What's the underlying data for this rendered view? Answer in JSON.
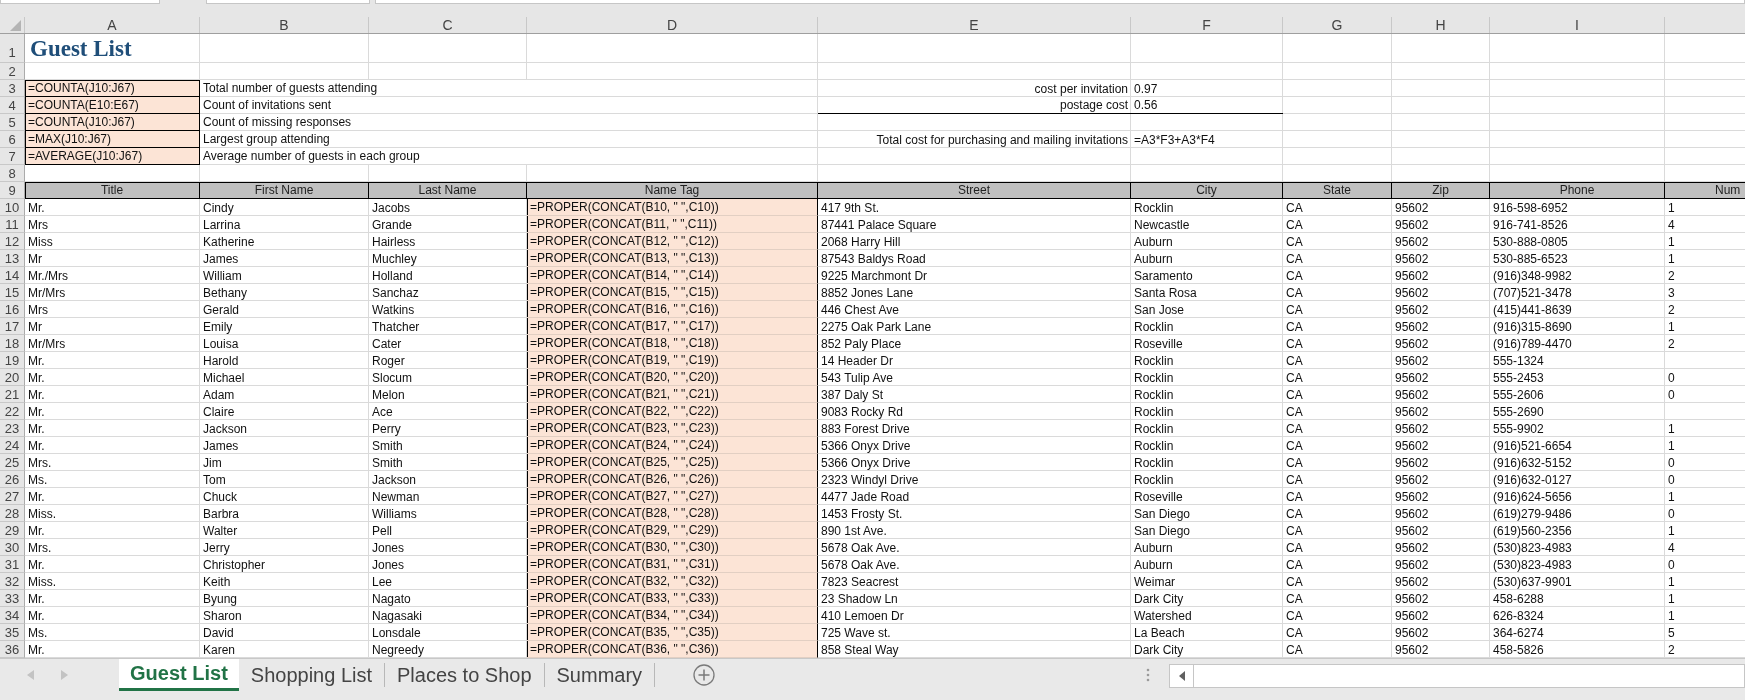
{
  "column_letters": [
    "A",
    "B",
    "C",
    "D",
    "E",
    "F",
    "G",
    "H",
    "I"
  ],
  "row_numbers": [
    "1",
    "2",
    "3",
    "4",
    "5",
    "6",
    "7",
    "8",
    "9",
    "10",
    "11",
    "12",
    "13",
    "14",
    "15",
    "16",
    "17",
    "18",
    "19",
    "20",
    "21",
    "22",
    "23",
    "24",
    "25",
    "26",
    "27",
    "28",
    "29",
    "30",
    "31",
    "32",
    "33",
    "34",
    "35",
    "36"
  ],
  "title": "Guest List",
  "summary": [
    {
      "formula": "=COUNTA(J10:J67)",
      "label": "Total number of guests attending"
    },
    {
      "formula": "=COUNTA(E10:E67)",
      "label": "Count of invitations sent"
    },
    {
      "formula": "=COUNTA(J10:J67)",
      "label": "Count of missing responses"
    },
    {
      "formula": "=MAX(J10:J67)",
      "label": "Largest group attending"
    },
    {
      "formula": "=AVERAGE(J10:J67)",
      "label": "Average number of guests in each group"
    }
  ],
  "costs": {
    "inputs": [
      {
        "label": "cost per invitation",
        "value": "0.97"
      },
      {
        "label": "postage cost",
        "value": "0.56"
      }
    ],
    "total": {
      "label": "Total cost for purchasing and mailing invitations",
      "value": "=A3*F3+A3*F4"
    }
  },
  "table": {
    "columns": [
      {
        "label": "Title",
        "kind": "text"
      },
      {
        "label": "First Name",
        "kind": "text"
      },
      {
        "label": "Last Name",
        "kind": "text"
      },
      {
        "label": "Name Tag",
        "kind": "formula"
      },
      {
        "label": "Street",
        "kind": "text"
      },
      {
        "label": "City",
        "kind": "text"
      },
      {
        "label": "State",
        "kind": "text"
      },
      {
        "label": "Zip",
        "kind": "text"
      },
      {
        "label": "Phone",
        "kind": "text"
      },
      {
        "label": "Num",
        "kind": "text"
      }
    ],
    "rows": [
      [
        "Mr.",
        "Cindy",
        "Jacobs",
        "=PROPER(CONCAT(B10, \" \",C10))",
        "417 9th St.",
        "Rocklin",
        "CA",
        "95602",
        "916-598-6952",
        "1"
      ],
      [
        "Mrs",
        "Larrina",
        "Grande",
        "=PROPER(CONCAT(B11, \" \",C11))",
        "87441 Palace Square",
        "Newcastle",
        "CA",
        "95602",
        "916-741-8526",
        "4"
      ],
      [
        "Miss",
        "Katherine",
        "Hairless",
        "=PROPER(CONCAT(B12, \" \",C12))",
        "2068 Harry Hill",
        "Auburn",
        "CA",
        "95602",
        "530-888-0805",
        "1"
      ],
      [
        "Mr",
        "James",
        "Muchley",
        "=PROPER(CONCAT(B13, \" \",C13))",
        "87543 Baldys Road",
        "Auburn",
        "CA",
        "95602",
        "530-885-6523",
        "1"
      ],
      [
        "Mr./Mrs",
        "William",
        "Holland",
        "=PROPER(CONCAT(B14, \" \",C14))",
        "9225 Marchmont Dr",
        "Saramento",
        "CA",
        "95602",
        "(916)348-9982",
        "2"
      ],
      [
        "Mr/Mrs",
        "Bethany",
        "Sanchaz",
        "=PROPER(CONCAT(B15, \" \",C15))",
        "8852 Jones Lane",
        "Santa Rosa",
        "CA",
        "95602",
        "(707)521-3478",
        "3"
      ],
      [
        "Mrs",
        "Gerald",
        "Watkins",
        "=PROPER(CONCAT(B16, \" \",C16))",
        "446 Chest Ave",
        "San Jose",
        "CA",
        "95602",
        "(415)441-8639",
        "2"
      ],
      [
        "Mr",
        "Emily",
        "Thatcher",
        "=PROPER(CONCAT(B17, \" \",C17))",
        "2275 Oak Park Lane",
        "Rocklin",
        "CA",
        "95602",
        "(916)315-8690",
        "1"
      ],
      [
        "Mr/Mrs",
        "Louisa",
        "Cater",
        "=PROPER(CONCAT(B18, \" \",C18))",
        "852 Paly Place",
        "Roseville",
        "CA",
        "95602",
        "(916)789-4470",
        "2"
      ],
      [
        "Mr.",
        "Harold",
        "Roger",
        "=PROPER(CONCAT(B19, \" \",C19))",
        "14 Header Dr",
        "Rocklin",
        "CA",
        "95602",
        "555-1324",
        null
      ],
      [
        "Mr.",
        "Michael",
        "Slocum",
        "=PROPER(CONCAT(B20, \" \",C20))",
        "543 Tulip Ave",
        "Rocklin",
        "CA",
        "95602",
        "555-2453",
        "0"
      ],
      [
        "Mr.",
        "Adam",
        "Melon",
        "=PROPER(CONCAT(B21, \" \",C21))",
        "387 Daly St",
        "Rocklin",
        "CA",
        "95602",
        "555-2606",
        "0"
      ],
      [
        "Mr.",
        "Claire",
        "Ace",
        "=PROPER(CONCAT(B22, \" \",C22))",
        "9083 Rocky Rd",
        "Rocklin",
        "CA",
        "95602",
        "555-2690",
        null
      ],
      [
        "Mr.",
        "Jackson",
        "Perry",
        "=PROPER(CONCAT(B23, \" \",C23))",
        "883 Forest Drive",
        "Rocklin",
        "CA",
        "95602",
        "555-9902",
        "1"
      ],
      [
        "Mr.",
        "James",
        "Smith",
        "=PROPER(CONCAT(B24, \" \",C24))",
        "5366 Onyx Drive",
        "Rocklin",
        "CA",
        "95602",
        "(916)521-6654",
        "1"
      ],
      [
        "Mrs.",
        "Jim",
        "Smith",
        "=PROPER(CONCAT(B25, \" \",C25))",
        "5366 Onyx Drive",
        "Rocklin",
        "CA",
        "95602",
        "(916)632-5152",
        "0"
      ],
      [
        "Ms.",
        "Tom",
        "Jackson",
        "=PROPER(CONCAT(B26, \" \",C26))",
        "2323 Windyl Drive",
        "Rocklin",
        "CA",
        "95602",
        "(916)632-0127",
        "0"
      ],
      [
        "Mr.",
        "Chuck",
        "Newman",
        "=PROPER(CONCAT(B27, \" \",C27))",
        "4477 Jade Road",
        "Roseville",
        "CA",
        "95602",
        "(916)624-5656",
        "1"
      ],
      [
        "Miss.",
        "Barbra",
        "Williams",
        "=PROPER(CONCAT(B28, \" \",C28))",
        "1453 Frosty St.",
        "San Diego",
        "CA",
        "95602",
        "(619)279-9486",
        "0"
      ],
      [
        "Mr.",
        "Walter",
        "Pell",
        "=PROPER(CONCAT(B29, \" \",C29))",
        "890 1st Ave.",
        "San Diego",
        "CA",
        "95602",
        "(619)560-2356",
        "1"
      ],
      [
        "Mrs.",
        "Jerry",
        "Jones",
        "=PROPER(CONCAT(B30, \" \",C30))",
        "5678 Oak Ave.",
        "Auburn",
        "CA",
        "95602",
        "(530)823-4983",
        "4"
      ],
      [
        "Mr.",
        "Christopher",
        "Jones",
        "=PROPER(CONCAT(B31, \" \",C31))",
        "5678 Oak Ave.",
        "Auburn",
        "CA",
        "95602",
        "(530)823-4983",
        "0"
      ],
      [
        "Miss.",
        "Keith",
        "Lee",
        "=PROPER(CONCAT(B32, \" \",C32))",
        "7823 Seacrest",
        "Weimar",
        "CA",
        "95602",
        "(530)637-9901",
        "1"
      ],
      [
        "Mr.",
        "Byung",
        "Nagato",
        "=PROPER(CONCAT(B33, \" \",C33))",
        "23 Shadow Ln",
        "Dark City",
        "CA",
        "95602",
        "458-6288",
        "1"
      ],
      [
        "Mr.",
        "Sharon",
        "Nagasaki",
        "=PROPER(CONCAT(B34, \" \",C34))",
        "410 Lemoen Dr",
        "Watershed",
        "CA",
        "95602",
        "626-8324",
        "1"
      ],
      [
        "Ms.",
        "David",
        "Lonsdale",
        "=PROPER(CONCAT(B35, \" \",C35))",
        "725 Wave st.",
        "La Beach",
        "CA",
        "95602",
        "364-6274",
        "5"
      ],
      [
        "Mr.",
        "Karen",
        "Negreedy",
        "=PROPER(CONCAT(B36, \" \",C36))",
        "858 Steal Way",
        "Dark City",
        "CA",
        "95602",
        "458-5826",
        "2"
      ]
    ]
  },
  "sheet_tabs": [
    {
      "label": "Guest List",
      "selected": true
    },
    {
      "label": "Shopping List",
      "selected": false
    },
    {
      "label": "Places to Shop",
      "selected": false
    },
    {
      "label": "Summary",
      "selected": false
    }
  ]
}
